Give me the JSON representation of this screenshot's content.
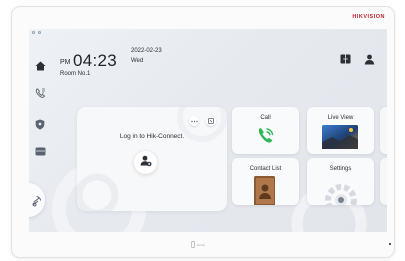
{
  "device": {
    "brand": "HIKVISION",
    "home_button_label": "Home"
  },
  "header": {
    "ampm": "PM",
    "time": "04:23",
    "date": "2022-02-23",
    "weekday": "Wed",
    "room": "Room No.1"
  },
  "sidebar": {
    "icons": [
      "home-icon",
      "call-log-icon",
      "shield-icon",
      "message-icon",
      "unlock-icon"
    ]
  },
  "top_right": {
    "icons": [
      "door-icon",
      "user-icon"
    ]
  },
  "hik_connect": {
    "title": "Log in to Hik-Connect.",
    "icons": [
      "more-icon",
      "expand-icon",
      "add-user-icon"
    ]
  },
  "tiles": [
    {
      "label": "Call",
      "icon": "phone-icon"
    },
    {
      "label": "Live View",
      "icon": "camera-icon"
    },
    {
      "label": "Contact List",
      "icon": "contact-book-icon"
    },
    {
      "label": "Settings",
      "icon": "gear-icon"
    }
  ],
  "colors": {
    "brand": "#c0262d",
    "call_green": "#2fb55a",
    "screen_bg": "#e6eaef"
  }
}
